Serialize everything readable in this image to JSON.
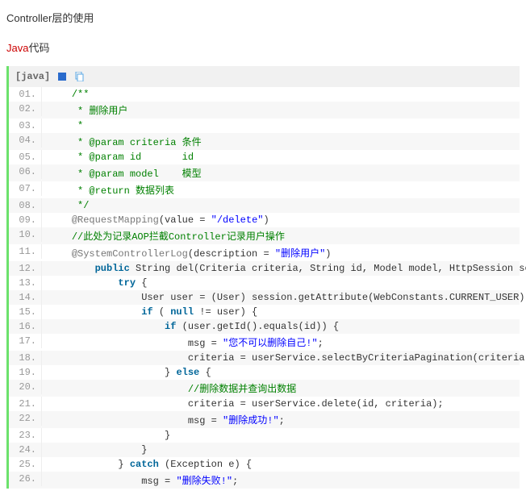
{
  "heading": "Controller层的使用",
  "subheading": {
    "red": "Java",
    "rest": "代码"
  },
  "code_header": {
    "lang": "[java]"
  },
  "icons": {
    "view": "view-source-icon",
    "copy": "copy-icon"
  },
  "code_lines": [
    {
      "n": "01.",
      "indent": 1,
      "tokens": [
        {
          "cls": "tok-comment",
          "t": "/**"
        }
      ]
    },
    {
      "n": "02.",
      "indent": 1,
      "tokens": [
        {
          "cls": "tok-comment",
          "t": " * 删除用户"
        }
      ]
    },
    {
      "n": "03.",
      "indent": 1,
      "tokens": [
        {
          "cls": "tok-comment",
          "t": " *"
        }
      ]
    },
    {
      "n": "04.",
      "indent": 1,
      "tokens": [
        {
          "cls": "tok-comment",
          "t": " * @param criteria 条件"
        }
      ]
    },
    {
      "n": "05.",
      "indent": 1,
      "tokens": [
        {
          "cls": "tok-comment",
          "t": " * @param id       id"
        }
      ]
    },
    {
      "n": "06.",
      "indent": 1,
      "tokens": [
        {
          "cls": "tok-comment",
          "t": " * @param model    模型"
        }
      ]
    },
    {
      "n": "07.",
      "indent": 1,
      "tokens": [
        {
          "cls": "tok-comment",
          "t": " * @return 数据列表"
        }
      ]
    },
    {
      "n": "08.",
      "indent": 1,
      "tokens": [
        {
          "cls": "tok-comment",
          "t": " */"
        }
      ]
    },
    {
      "n": "09.",
      "indent": 1,
      "tokens": [
        {
          "cls": "tok-ann",
          "t": "@RequestMapping"
        },
        {
          "cls": "tok-punc",
          "t": "(value = "
        },
        {
          "cls": "tok-string",
          "t": "\"/delete\""
        },
        {
          "cls": "tok-punc",
          "t": ")"
        }
      ]
    },
    {
      "n": "10.",
      "indent": 1,
      "tokens": [
        {
          "cls": "tok-comment",
          "t": "//此处为记录AOP拦截Controller记录用户操作"
        }
      ]
    },
    {
      "n": "11.",
      "indent": 1,
      "tokens": [
        {
          "cls": "tok-ann",
          "t": "@SystemControllerLog"
        },
        {
          "cls": "tok-punc",
          "t": "(description = "
        },
        {
          "cls": "tok-string",
          "t": "\"删除用户\""
        },
        {
          "cls": "tok-punc",
          "t": ")"
        }
      ]
    },
    {
      "n": "12.",
      "indent": 2,
      "tokens": [
        {
          "cls": "tok-keyword",
          "t": "public"
        },
        {
          "cls": "tok-plain",
          "t": " String del(Criteria criteria, String id, Model model, HttpSession session) {"
        }
      ]
    },
    {
      "n": "13.",
      "indent": 3,
      "tokens": [
        {
          "cls": "tok-keyword",
          "t": "try"
        },
        {
          "cls": "tok-plain",
          "t": " {"
        }
      ]
    },
    {
      "n": "14.",
      "indent": 4,
      "tokens": [
        {
          "cls": "tok-plain",
          "t": "User user = (User) session.getAttribute(WebConstants.CURRENT_USER);"
        }
      ]
    },
    {
      "n": "15.",
      "indent": 4,
      "tokens": [
        {
          "cls": "tok-keyword",
          "t": "if"
        },
        {
          "cls": "tok-plain",
          "t": " ( "
        },
        {
          "cls": "tok-keyword",
          "t": "null"
        },
        {
          "cls": "tok-plain",
          "t": " != user) {"
        }
      ]
    },
    {
      "n": "16.",
      "indent": 5,
      "tokens": [
        {
          "cls": "tok-keyword",
          "t": "if"
        },
        {
          "cls": "tok-plain",
          "t": " (user.getId().equals(id)) {"
        }
      ]
    },
    {
      "n": "17.",
      "indent": 6,
      "tokens": [
        {
          "cls": "tok-plain",
          "t": "msg = "
        },
        {
          "cls": "tok-string",
          "t": "\"您不可以删除自己!\""
        },
        {
          "cls": "tok-plain",
          "t": ";"
        }
      ]
    },
    {
      "n": "18.",
      "indent": 6,
      "tokens": [
        {
          "cls": "tok-plain",
          "t": "criteria = userService.selectByCriteriaPagination(criteria);"
        }
      ]
    },
    {
      "n": "19.",
      "indent": 5,
      "tokens": [
        {
          "cls": "tok-plain",
          "t": "} "
        },
        {
          "cls": "tok-keyword",
          "t": "else"
        },
        {
          "cls": "tok-plain",
          "t": " {"
        }
      ]
    },
    {
      "n": "20.",
      "indent": 6,
      "tokens": [
        {
          "cls": "tok-comment",
          "t": "//删除数据并查询出数据"
        }
      ]
    },
    {
      "n": "21.",
      "indent": 6,
      "tokens": [
        {
          "cls": "tok-plain",
          "t": "criteria = userService.delete(id, criteria);"
        }
      ]
    },
    {
      "n": "22.",
      "indent": 6,
      "tokens": [
        {
          "cls": "tok-plain",
          "t": "msg = "
        },
        {
          "cls": "tok-string",
          "t": "\"删除成功!\""
        },
        {
          "cls": "tok-plain",
          "t": ";"
        }
      ]
    },
    {
      "n": "23.",
      "indent": 5,
      "tokens": [
        {
          "cls": "tok-plain",
          "t": "}"
        }
      ]
    },
    {
      "n": "24.",
      "indent": 4,
      "tokens": [
        {
          "cls": "tok-plain",
          "t": "}"
        }
      ]
    },
    {
      "n": "25.",
      "indent": 3,
      "tokens": [
        {
          "cls": "tok-plain",
          "t": "} "
        },
        {
          "cls": "tok-keyword",
          "t": "catch"
        },
        {
          "cls": "tok-plain",
          "t": " (Exception e) {"
        }
      ]
    },
    {
      "n": "26.",
      "indent": 4,
      "tokens": [
        {
          "cls": "tok-plain",
          "t": "msg = "
        },
        {
          "cls": "tok-string",
          "t": "\"删除失败!\""
        },
        {
          "cls": "tok-plain",
          "t": ";"
        }
      ]
    }
  ],
  "indent_unit": "    "
}
